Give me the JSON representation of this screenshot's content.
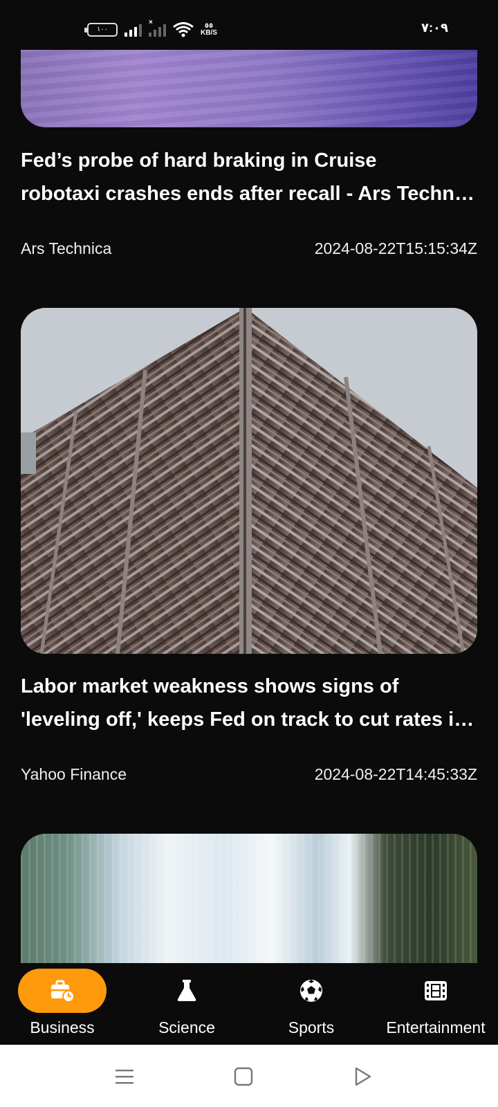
{
  "status_bar": {
    "battery": "١٠٠",
    "speed_value": "٥٥",
    "speed_unit": "KB/S",
    "time": "٧:٠٩"
  },
  "articles": [
    {
      "title_line1": "Fed’s probe of hard braking in Cruise",
      "title_line2": "robotaxi crashes ends after recall - Ars Technica",
      "source": "Ars Technica",
      "published": "2024-08-22T15:15:34Z",
      "image": "purple-abstract"
    },
    {
      "title_line1": "Labor market weakness shows signs of",
      "title_line2": "'leveling off,' keeps Fed on track to cut rates in September",
      "source": "Yahoo Finance",
      "published": "2024-08-22T14:45:33Z",
      "image": "building-corner"
    },
    {
      "image": "waterfall"
    }
  ],
  "bottom_nav": {
    "active": "Business",
    "items": [
      {
        "label": "Business",
        "icon": "briefcase-clock-icon"
      },
      {
        "label": "Science",
        "icon": "flask-icon"
      },
      {
        "label": "Sports",
        "icon": "soccer-ball-icon"
      },
      {
        "label": "Entertainment",
        "icon": "film-icon"
      }
    ]
  },
  "system_nav": {
    "buttons": [
      "menu-icon",
      "home-icon",
      "back-icon"
    ]
  },
  "colors": {
    "background": "#0b0b0c",
    "accent": "#ff9a0d",
    "text": "#ffffff"
  }
}
